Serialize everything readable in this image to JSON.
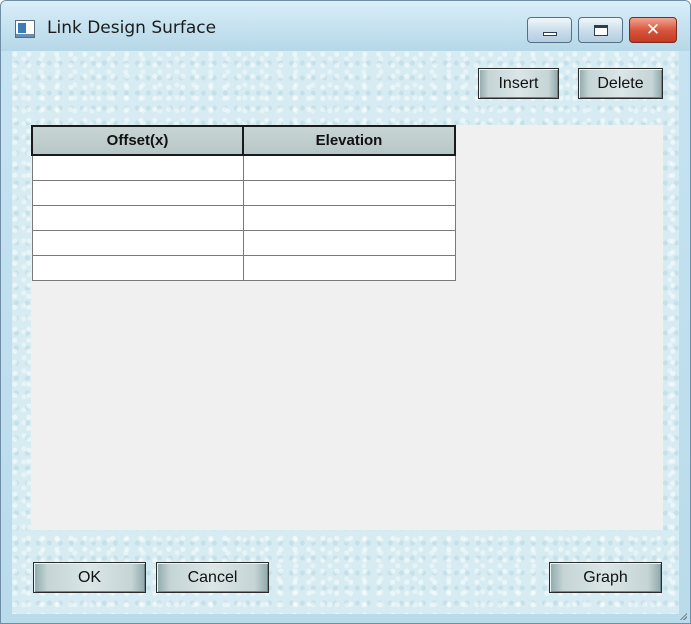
{
  "window": {
    "title": "Link Design Surface"
  },
  "toolbar": {
    "insert_label": "Insert",
    "delete_label": "Delete"
  },
  "table": {
    "columns": [
      "Offset(x)",
      "Elevation"
    ],
    "rows": [
      [
        "",
        ""
      ],
      [
        "",
        ""
      ],
      [
        "",
        ""
      ],
      [
        "",
        ""
      ],
      [
        "",
        ""
      ]
    ]
  },
  "footer": {
    "ok_label": "OK",
    "cancel_label": "Cancel",
    "graph_label": "Graph"
  },
  "icons": {
    "app": "app-window-icon",
    "minimize": "minimize-icon",
    "maximize": "maximize-icon",
    "close": "close-icon"
  },
  "colors": {
    "close_button": "#d8563d",
    "client_background": "#d7ecf2",
    "grid_background": "#f0f0f0"
  }
}
